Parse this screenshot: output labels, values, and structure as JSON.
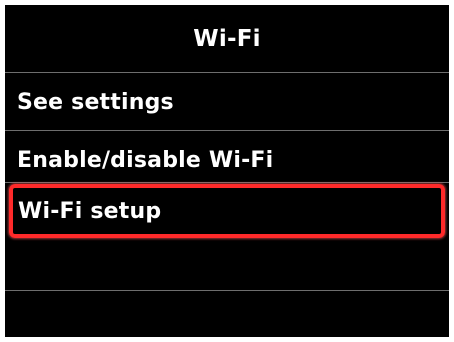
{
  "header": {
    "title": "Wi-Fi"
  },
  "menu": {
    "items": [
      {
        "label": "See settings",
        "selected": false
      },
      {
        "label": "Enable/disable Wi-Fi",
        "selected": false
      },
      {
        "label": "Wi-Fi setup",
        "selected": true
      }
    ]
  },
  "colors": {
    "background": "#000000",
    "text": "#ffffff",
    "divider": "#6e6e6e",
    "selection_border": "#ff2a2a"
  }
}
